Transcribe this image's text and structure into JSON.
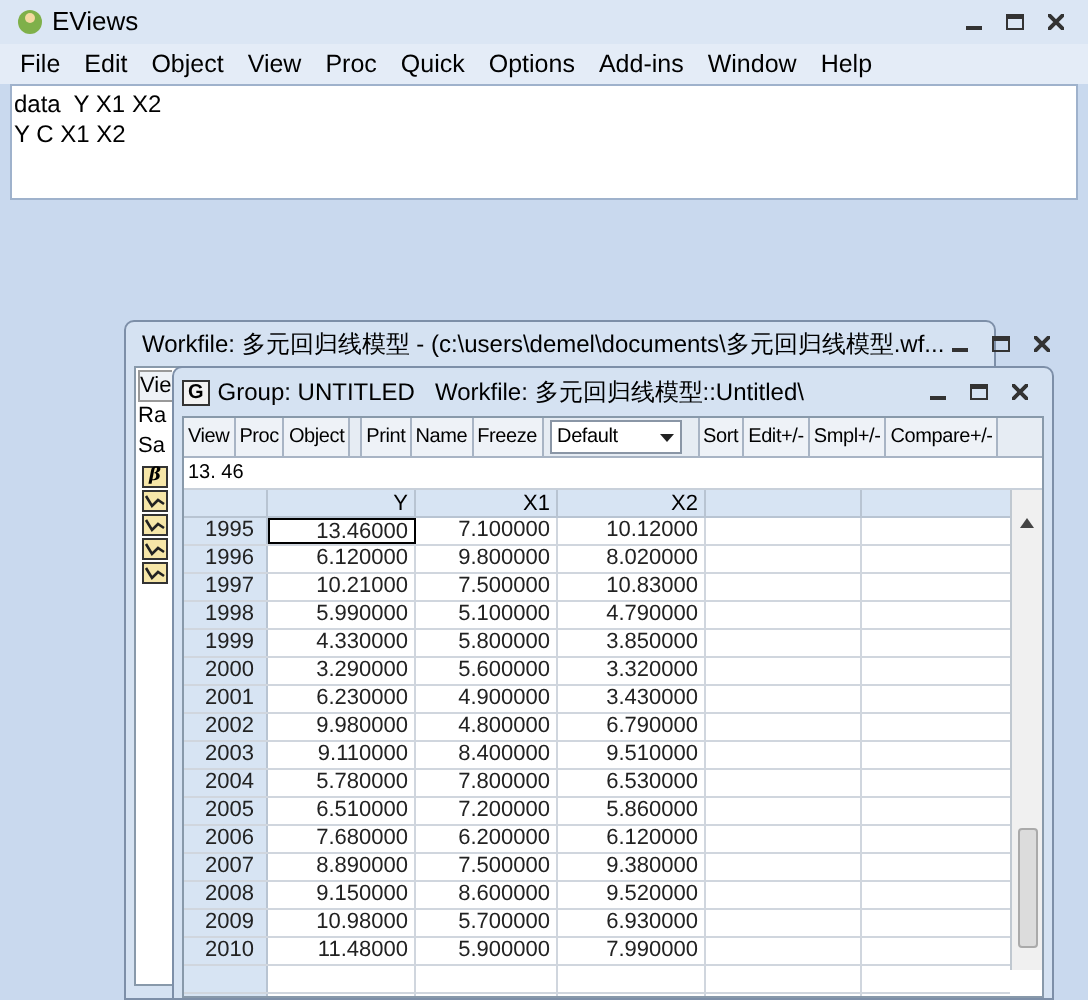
{
  "app": {
    "title": "EViews",
    "menu": [
      "File",
      "Edit",
      "Object",
      "View",
      "Proc",
      "Quick",
      "Options",
      "Add-ins",
      "Window",
      "Help"
    ]
  },
  "command": {
    "lines": [
      "data  Y X1 X2",
      "Y C X1 X2"
    ]
  },
  "workfile_window": {
    "title": "Workfile: 多元回归线模型 - (c:\\users\\demel\\documents\\多元回归线模型.wf...",
    "labels": [
      "Vie",
      "Ra",
      "Sa"
    ],
    "objects": [
      {
        "kind": "coef",
        "symbol": "β"
      },
      {
        "kind": "series"
      },
      {
        "kind": "series"
      },
      {
        "kind": "series"
      },
      {
        "kind": "series"
      }
    ]
  },
  "group_window": {
    "icon_letter": "G",
    "title": "Group: UNTITLED   Workfile: 多元回归线模型::Untitled\\",
    "toolbar": [
      {
        "kind": "button",
        "label": "View"
      },
      {
        "kind": "button",
        "label": "Proc"
      },
      {
        "kind": "button",
        "label": "Object"
      },
      {
        "kind": "gap"
      },
      {
        "kind": "button",
        "label": "Print"
      },
      {
        "kind": "button",
        "label": "Name"
      },
      {
        "kind": "button",
        "label": "Freeze"
      },
      {
        "kind": "dropdown",
        "label": "Default"
      },
      {
        "kind": "gap"
      },
      {
        "kind": "button",
        "label": "Sort"
      },
      {
        "kind": "button",
        "label": "Edit+/-"
      },
      {
        "kind": "button",
        "label": "Smpl+/-"
      },
      {
        "kind": "button",
        "label": "Compare+/-"
      }
    ],
    "edit_value": "13. 46",
    "table": {
      "columns": [
        "Y",
        "X1",
        "X2"
      ],
      "rows": [
        {
          "label": "1995",
          "cells": [
            "13.46000",
            "7.100000",
            "10.12000"
          ],
          "selected": true
        },
        {
          "label": "1996",
          "cells": [
            "6.120000",
            "9.800000",
            "8.020000"
          ],
          "selected": false
        },
        {
          "label": "1997",
          "cells": [
            "10.21000",
            "7.500000",
            "10.83000"
          ],
          "selected": false
        },
        {
          "label": "1998",
          "cells": [
            "5.990000",
            "5.100000",
            "4.790000"
          ],
          "selected": false
        },
        {
          "label": "1999",
          "cells": [
            "4.330000",
            "5.800000",
            "3.850000"
          ],
          "selected": false
        },
        {
          "label": "2000",
          "cells": [
            "3.290000",
            "5.600000",
            "3.320000"
          ],
          "selected": false
        },
        {
          "label": "2001",
          "cells": [
            "6.230000",
            "4.900000",
            "3.430000"
          ],
          "selected": false
        },
        {
          "label": "2002",
          "cells": [
            "9.980000",
            "4.800000",
            "6.790000"
          ],
          "selected": false
        },
        {
          "label": "2003",
          "cells": [
            "9.110000",
            "8.400000",
            "9.510000"
          ],
          "selected": false
        },
        {
          "label": "2004",
          "cells": [
            "5.780000",
            "7.800000",
            "6.530000"
          ],
          "selected": false
        },
        {
          "label": "2005",
          "cells": [
            "6.510000",
            "7.200000",
            "5.860000"
          ],
          "selected": false
        },
        {
          "label": "2006",
          "cells": [
            "7.680000",
            "6.200000",
            "6.120000"
          ],
          "selected": false
        },
        {
          "label": "2007",
          "cells": [
            "8.890000",
            "7.500000",
            "9.380000"
          ],
          "selected": false
        },
        {
          "label": "2008",
          "cells": [
            "9.150000",
            "8.600000",
            "9.520000"
          ],
          "selected": false
        },
        {
          "label": "2009",
          "cells": [
            "10.98000",
            "5.700000",
            "6.930000"
          ],
          "selected": false
        },
        {
          "label": "2010",
          "cells": [
            "11.48000",
            "5.900000",
            "7.990000"
          ],
          "selected": false
        }
      ]
    }
  }
}
